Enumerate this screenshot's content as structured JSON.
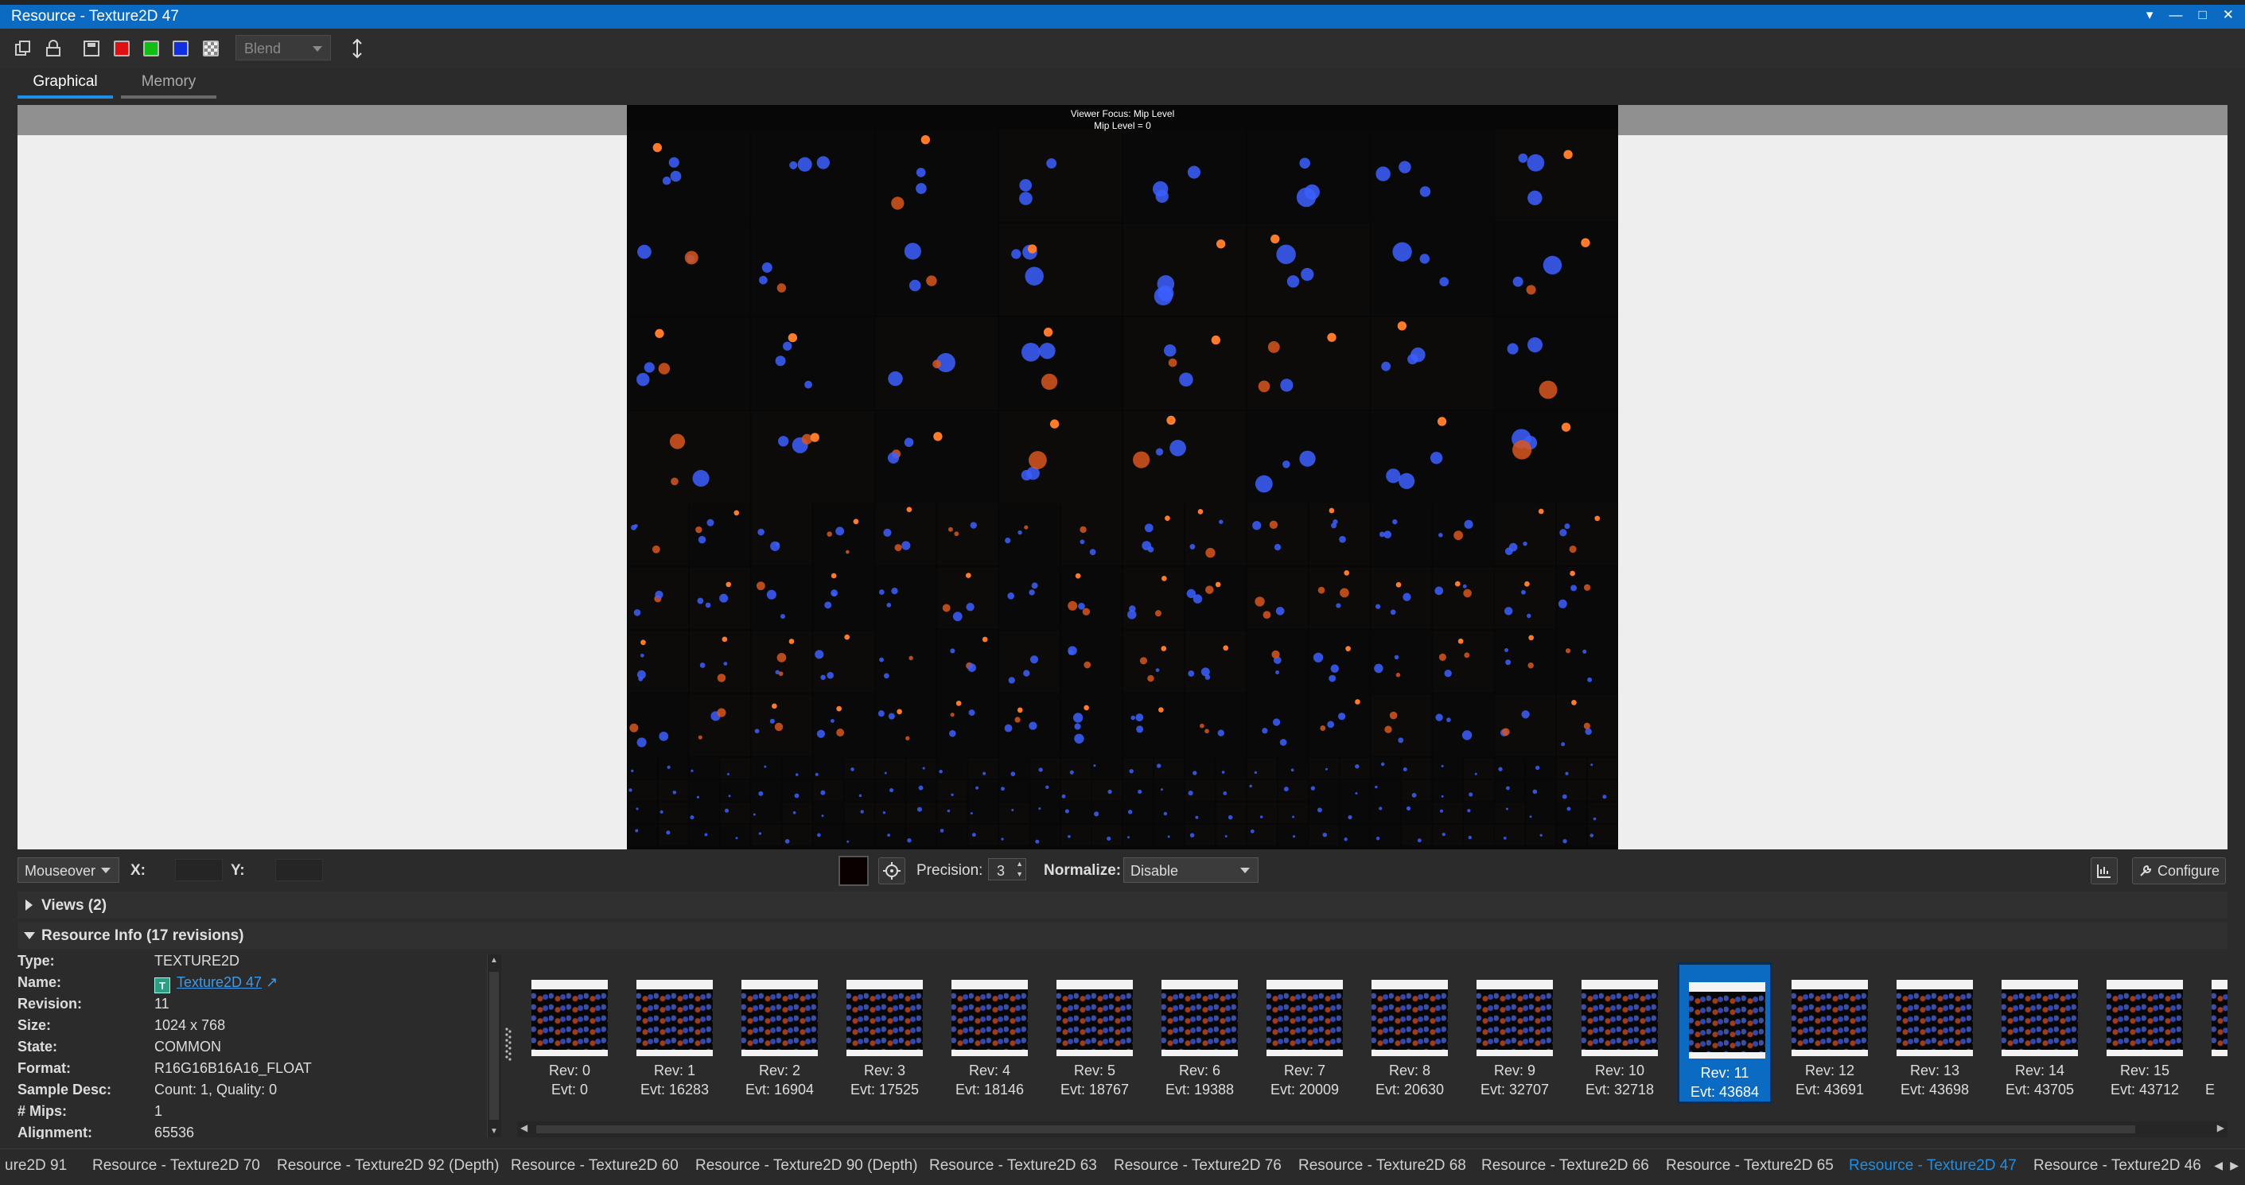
{
  "window": {
    "title": "Resource - Texture2D 47"
  },
  "toolbar": {
    "icons": [
      "copy-icon",
      "lock-icon",
      "save-icon",
      "red-channel",
      "green-channel",
      "blue-channel",
      "alpha-channel",
      "flip-vertical-icon"
    ],
    "colors": {
      "red": "#e01010",
      "green": "#10c010",
      "blue": "#1030e0",
      "alpha": "#e8e8e8"
    },
    "blend_label": "Blend"
  },
  "tabs": [
    {
      "label": "Graphical"
    },
    {
      "label": "Memory"
    }
  ],
  "viewer": {
    "overlay_line1": "Viewer Focus: Mip Level",
    "overlay_line2": "Mip Level = 0"
  },
  "status": {
    "mode": "Mouseover",
    "x_label": "X:",
    "y_label": "Y:",
    "precision_label": "Precision:",
    "precision_value": "3",
    "normalize_label": "Normalize:",
    "normalize_value": "Disable",
    "configure_label": "Configure"
  },
  "sections": {
    "views": "Views (2)",
    "resource_info": "Resource Info (17 revisions)"
  },
  "info": [
    {
      "k": "Type:",
      "v": "TEXTURE2D"
    },
    {
      "k": "Name:",
      "v": "Texture2D 47"
    },
    {
      "k": "Revision:",
      "v": "11"
    },
    {
      "k": "Size:",
      "v": "1024 x 768"
    },
    {
      "k": "State:",
      "v": "COMMON"
    },
    {
      "k": "Format:",
      "v": "R16G16B16A16_FLOAT"
    },
    {
      "k": "Sample Desc:",
      "v": "Count: 1, Quality: 0"
    },
    {
      "k": "# Mips:",
      "v": "1"
    },
    {
      "k": "Alignment:",
      "v": "65536"
    }
  ],
  "revisions": [
    {
      "rev": "Rev: 0",
      "evt": "Evt: 0"
    },
    {
      "rev": "Rev: 1",
      "evt": "Evt: 16283"
    },
    {
      "rev": "Rev: 2",
      "evt": "Evt: 16904"
    },
    {
      "rev": "Rev: 3",
      "evt": "Evt: 17525"
    },
    {
      "rev": "Rev: 4",
      "evt": "Evt: 18146"
    },
    {
      "rev": "Rev: 5",
      "evt": "Evt: 18767"
    },
    {
      "rev": "Rev: 6",
      "evt": "Evt: 19388"
    },
    {
      "rev": "Rev: 7",
      "evt": "Evt: 20009"
    },
    {
      "rev": "Rev: 8",
      "evt": "Evt: 20630"
    },
    {
      "rev": "Rev: 9",
      "evt": "Evt: 32707"
    },
    {
      "rev": "Rev: 10",
      "evt": "Evt: 32718"
    },
    {
      "rev": "Rev: 11",
      "evt": "Evt: 43684"
    },
    {
      "rev": "Rev: 12",
      "evt": "Evt: 43691"
    },
    {
      "rev": "Rev: 13",
      "evt": "Evt: 43698"
    },
    {
      "rev": "Rev: 14",
      "evt": "Evt: 43705"
    },
    {
      "rev": "Rev: 15",
      "evt": "Evt: 43712"
    },
    {
      "rev": "",
      "evt": "E"
    }
  ],
  "selected_revision": 11,
  "bottom_tabs": [
    {
      "label": "ure2D 91"
    },
    {
      "label": "Resource - Texture2D 70"
    },
    {
      "label": "Resource - Texture2D 92 (Depth)"
    },
    {
      "label": "Resource - Texture2D 60"
    },
    {
      "label": "Resource - Texture2D 90 (Depth)"
    },
    {
      "label": "Resource - Texture2D 63"
    },
    {
      "label": "Resource - Texture2D 76"
    },
    {
      "label": "Resource - Texture2D 68"
    },
    {
      "label": "Resource - Texture2D 66"
    },
    {
      "label": "Resource - Texture2D 65"
    },
    {
      "label": "Resource - Texture2D 47"
    },
    {
      "label": "Resource - Texture2D 46"
    }
  ],
  "active_bottom_tab": 10
}
